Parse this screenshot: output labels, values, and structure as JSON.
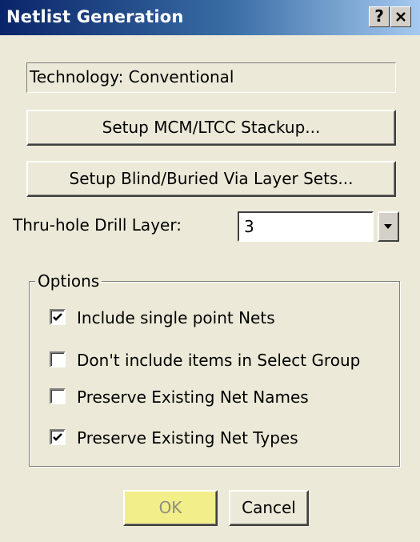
{
  "window": {
    "title": "Netlist Generation",
    "help_label": "?",
    "close_label": "✕"
  },
  "technology_text": "Technology: Conventional",
  "buttons": {
    "setup_stackup": "Setup MCM/LTCC Stackup...",
    "setup_via_sets": "Setup Blind/Buried Via Layer Sets..."
  },
  "drill": {
    "label": "Thru-hole Drill Layer:",
    "value": "3"
  },
  "options": {
    "legend": "Options",
    "items": [
      {
        "label": "Include single point Nets",
        "checked": true
      },
      {
        "label": "Don't include items in Select Group",
        "checked": false
      },
      {
        "label": "Preserve Existing Net Names",
        "checked": false
      },
      {
        "label": "Preserve Existing Net Types",
        "checked": true
      }
    ]
  },
  "footer": {
    "ok_label": "OK",
    "cancel_label": "Cancel"
  },
  "colors": {
    "title_gradient_start": "#0a246a",
    "dialog_bg": "#ece9d8",
    "ok_highlight": "#f2ee8a"
  }
}
